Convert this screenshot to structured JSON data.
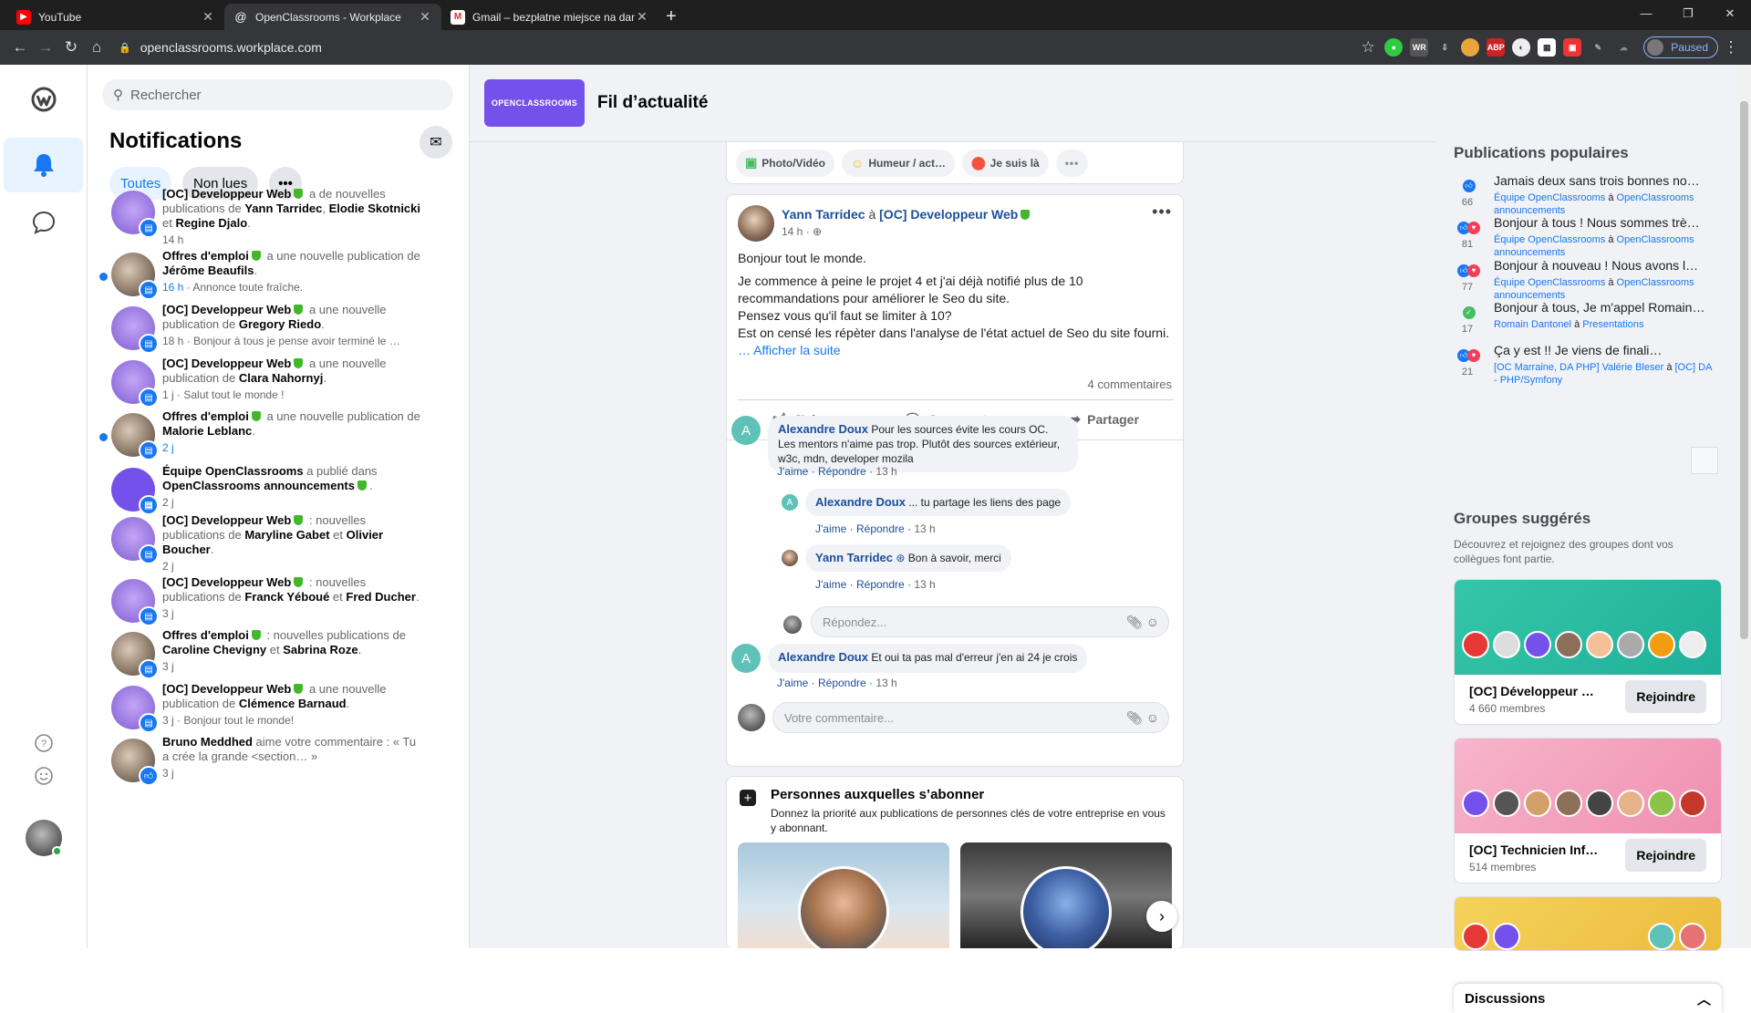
{
  "browser": {
    "tabs": [
      {
        "title": "YouTube",
        "icon": "youtube-icon"
      },
      {
        "title": "OpenClassrooms - Workplace",
        "icon": "workplace-icon"
      },
      {
        "title": "Gmail – bezpłatne miejsce na dane",
        "icon": "gmail-icon"
      }
    ],
    "url": "openclassrooms.workplace.com",
    "profile_status": "Paused"
  },
  "search": {
    "placeholder": "Rechercher"
  },
  "notifications": {
    "title": "Notifications",
    "filters": [
      "Toutes",
      "Non lues"
    ],
    "items": [
      {
        "parts": [
          [
            "b",
            "[OC] Developpeur Web"
          ],
          [
            "s",
            ""
          ],
          [
            "t",
            " a de nouvelles publications de "
          ],
          [
            "b",
            "Yann Tarridec"
          ],
          [
            "t",
            ", "
          ],
          [
            "b",
            "Elodie Skotnicki"
          ],
          [
            "t",
            " et "
          ],
          [
            "b",
            "Regine Djalo"
          ],
          [
            "t",
            "."
          ]
        ],
        "time": "14 h",
        "unread": false,
        "avatar": "group"
      },
      {
        "parts": [
          [
            "b",
            "Offres d'emploi"
          ],
          [
            "s",
            ""
          ],
          [
            "t",
            " a une nouvelle publication de "
          ],
          [
            "b",
            "Jérôme Beaufils"
          ],
          [
            "t",
            "."
          ]
        ],
        "time": "16 h",
        "snippet": "Annonce toute fraîche.",
        "unread": true,
        "avatar": "photo"
      },
      {
        "parts": [
          [
            "b",
            "[OC] Developpeur Web"
          ],
          [
            "s",
            ""
          ],
          [
            "t",
            " a une nouvelle publication de "
          ],
          [
            "b",
            "Gregory Riedo"
          ],
          [
            "t",
            "."
          ]
        ],
        "time": "18 h",
        "snippet": "Bonjour à tous je pense avoir terminé le …",
        "unread": false,
        "avatar": "group"
      },
      {
        "parts": [
          [
            "b",
            "[OC] Developpeur Web"
          ],
          [
            "s",
            ""
          ],
          [
            "t",
            " a une nouvelle publication de "
          ],
          [
            "b",
            "Clara Nahornyj"
          ],
          [
            "t",
            "."
          ]
        ],
        "time": "1 j",
        "snippet": "Salut tout le monde !",
        "unread": false,
        "avatar": "group"
      },
      {
        "parts": [
          [
            "b",
            "Offres d'emploi"
          ],
          [
            "s",
            ""
          ],
          [
            "t",
            " a une nouvelle publication de "
          ],
          [
            "b",
            "Malorie Leblanc"
          ],
          [
            "t",
            "."
          ]
        ],
        "time": "2 j",
        "unread": true,
        "avatar": "photo"
      },
      {
        "parts": [
          [
            "b",
            "Équipe OpenClassrooms"
          ],
          [
            "t",
            " a publié dans "
          ],
          [
            "b",
            "OpenClassrooms announcements"
          ],
          [
            "s",
            ""
          ],
          [
            "t",
            "."
          ]
        ],
        "time": "2 j",
        "unread": false,
        "avatar": "oc"
      },
      {
        "parts": [
          [
            "b",
            "[OC] Developpeur Web"
          ],
          [
            "s",
            ""
          ],
          [
            "t",
            " : nouvelles publications de "
          ],
          [
            "b",
            "Maryline Gabet"
          ],
          [
            "t",
            " et "
          ],
          [
            "b",
            "Olivier Boucher"
          ],
          [
            "t",
            "."
          ]
        ],
        "time": "2 j",
        "unread": false,
        "avatar": "group"
      },
      {
        "parts": [
          [
            "b",
            "[OC] Developpeur Web"
          ],
          [
            "s",
            ""
          ],
          [
            "t",
            " : nouvelles publications de "
          ],
          [
            "b",
            "Franck Yéboué"
          ],
          [
            "t",
            " et "
          ],
          [
            "b",
            "Fred Ducher"
          ],
          [
            "t",
            "."
          ]
        ],
        "time": "3 j",
        "unread": false,
        "avatar": "group"
      },
      {
        "parts": [
          [
            "b",
            "Offres d'emploi"
          ],
          [
            "s",
            ""
          ],
          [
            "t",
            " : nouvelles publications de "
          ],
          [
            "b",
            "Caroline Chevigny"
          ],
          [
            "t",
            " et "
          ],
          [
            "b",
            "Sabrina Roze"
          ],
          [
            "t",
            "."
          ]
        ],
        "time": "3 j",
        "unread": false,
        "avatar": "photo"
      },
      {
        "parts": [
          [
            "b",
            "[OC] Developpeur Web"
          ],
          [
            "s",
            ""
          ],
          [
            "t",
            " a une nouvelle publication de "
          ],
          [
            "b",
            "Clémence Barnaud"
          ],
          [
            "t",
            "."
          ]
        ],
        "time": "3 j",
        "snippet": "Bonjour tout le monde!",
        "unread": false,
        "avatar": "group"
      },
      {
        "parts": [
          [
            "b",
            "Bruno Meddhed"
          ],
          [
            "t",
            " aime votre commentaire : « Tu a crée la grande <section… »"
          ]
        ],
        "time": "3 j",
        "unread": false,
        "avatar": "person"
      }
    ]
  },
  "feed": {
    "logo_text": "OPENCLASSROOMS",
    "title": "Fil d’actualité",
    "composer": [
      {
        "label": "Photo/Vidéo",
        "icon": "photo-icon"
      },
      {
        "label": "Humeur / act…",
        "icon": "emoji-icon"
      },
      {
        "label": "Je suis là",
        "icon": "location-pin-icon"
      }
    ],
    "post": {
      "author": "Yann Tarridec",
      "arrow": "à",
      "group": "[OC] Developpeur Web",
      "time": "14 h",
      "body": [
        "Bonjour tout le monde.",
        "Je commence à peine le projet 4 et j'ai déjà notifié plus de 10 recommandations pour améliorer le Seo du site.\nPensez vous qu'il faut se limiter à 10?\nEst on censé les répèter dans l'analyse de l'état actuel de Seo du site fourni."
      ],
      "ellipsis": "…",
      "see_more": "Afficher la suite",
      "comments_count": "4 commentaires",
      "actions": [
        "J’aime",
        "Commenter",
        "Partager"
      ]
    },
    "comments": [
      {
        "author": "Alexandre Doux",
        "text": "Pour les sources évite les cours OC. Les mentors n'aime pas trop. Plutôt des sources extérieur, w3c, mdn, developer mozila",
        "like": "J'aime",
        "reply": "Répondre",
        "time": "13 h"
      },
      {
        "author": "Alexandre Doux",
        "text": "... tu partage les liens des page",
        "like": "J'aime",
        "reply": "Répondre",
        "time": "13 h"
      },
      {
        "author": "Yann Tarridec",
        "text": "Bon à savoir, merci",
        "like": "J'aime",
        "reply": "Répondre",
        "time": "13 h"
      },
      {
        "author": "Alexandre Doux",
        "text": "Et oui ta pas mal d'erreur j'en ai 24 je crois",
        "like": "J'aime",
        "reply": "Répondre",
        "time": "13 h"
      }
    ],
    "reply_placeholder": "Répondez...",
    "comment_placeholder": "Votre commentaire...",
    "suggest": {
      "title": "Personnes auxquelles s’abonner",
      "desc": "Donnez la priorité aux publications de personnes clés de votre entreprise en vous y abonnant."
    }
  },
  "right": {
    "popular_title": "Publications populaires",
    "popular": [
      {
        "title": "Jamais deux sans trois bonnes no…",
        "count": "66",
        "source": "Équipe OpenClassrooms",
        "sep": "à",
        "target": "OpenClassrooms announcements",
        "reacts": [
          "like"
        ]
      },
      {
        "title": "Bonjour à tous ! Nous sommes trè…",
        "count": "81",
        "source": "Équipe OpenClassrooms",
        "sep": "à",
        "target": "OpenClassrooms announcements",
        "reacts": [
          "like",
          "love"
        ]
      },
      {
        "title": "Bonjour à nouveau ! Nous avons l…",
        "count": "77",
        "source": "Équipe OpenClassrooms",
        "sep": "à",
        "target": "OpenClassrooms announcements",
        "reacts": [
          "like",
          "love"
        ]
      },
      {
        "title": "Bonjour à tous, Je m'appel Romain…",
        "count": "17",
        "source": "Romain Dantonel",
        "sep": "à",
        "target": "Presentations",
        "reacts": [
          "green"
        ]
      },
      {
        "title": "Ça y est !! Je viens de finali…",
        "count": "21",
        "source": "[OC Marraine, DA PHP] Valérie Bleser",
        "sep": "à",
        "target": "[OC] DA - PHP/Symfony",
        "reacts": [
          "like",
          "love"
        ]
      }
    ],
    "groups_title": "Groupes suggérés",
    "groups_desc": "Découvrez et rejoignez des groupes dont vos collègues font partie.",
    "groups": [
      {
        "name": "[OC] Développeur …",
        "members": "4 660 membres",
        "join": "Rejoindre",
        "color": "#35c6a8"
      },
      {
        "name": "[OC] Technicien Inf…",
        "members": "514 membres",
        "join": "Rejoindre",
        "color": "#f4a5c0"
      },
      {
        "name": "",
        "members": "",
        "join": "",
        "color": "#f2c94c"
      }
    ],
    "discussions": "Discussions"
  },
  "colors": {
    "accent": "#1877f2",
    "brand": "#7451eb"
  }
}
